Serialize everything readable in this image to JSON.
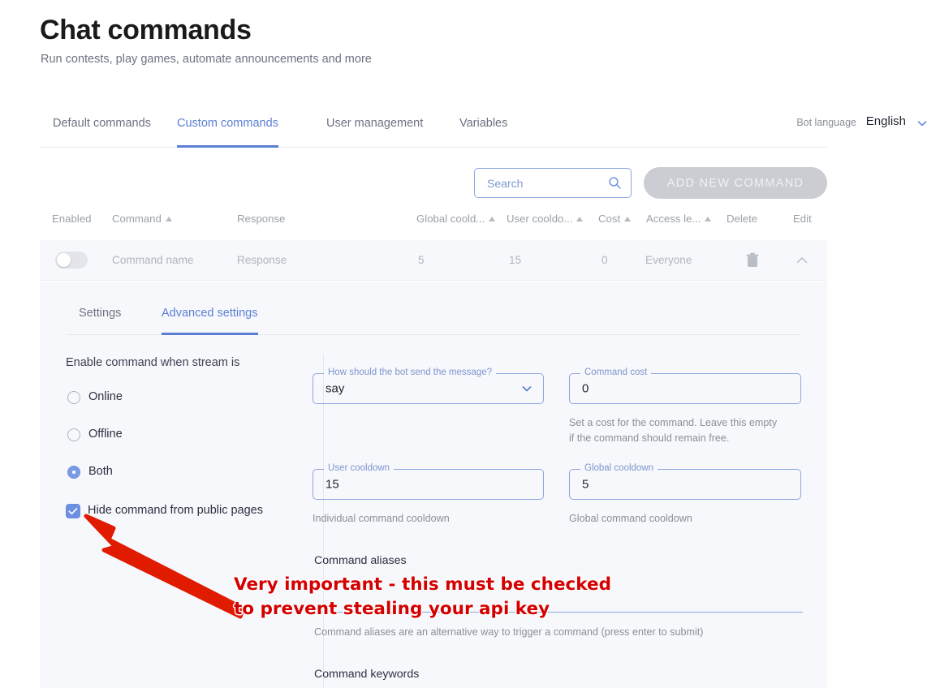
{
  "page": {
    "title": "Chat commands",
    "subtitle": "Run contests, play games, automate announcements and more"
  },
  "tabs": [
    {
      "label": "Default commands",
      "active": false
    },
    {
      "label": "Custom commands",
      "active": true
    },
    {
      "label": "User management",
      "active": false
    },
    {
      "label": "Variables",
      "active": false
    }
  ],
  "bot_language": {
    "label": "Bot language",
    "value": "English",
    "chevron_icon": "chevron-down-icon"
  },
  "toolbar": {
    "search_placeholder": "Search",
    "search_value": "",
    "search_icon": "search-icon",
    "add_button_label": "ADD NEW COMMAND"
  },
  "table": {
    "headers": [
      {
        "label": "Enabled",
        "sortable": false
      },
      {
        "label": "Command",
        "sortable": true
      },
      {
        "label": "Response",
        "sortable": false
      },
      {
        "label": "Global coold...",
        "sortable": true
      },
      {
        "label": "User cooldo...",
        "sortable": true
      },
      {
        "label": "Cost",
        "sortable": true
      },
      {
        "label": "Access le...",
        "sortable": true
      },
      {
        "label": "Delete",
        "sortable": false
      },
      {
        "label": "Edit",
        "sortable": false
      }
    ],
    "row": {
      "enabled": false,
      "command": "Command name",
      "response": "Response",
      "global_cooldown": "5",
      "user_cooldown": "15",
      "cost": "0",
      "access_level": "Everyone",
      "delete_icon": "trash-icon",
      "edit_icon": "chevron-up-icon"
    }
  },
  "panel": {
    "subtabs": [
      {
        "label": "Settings",
        "active": false
      },
      {
        "label": "Advanced settings",
        "active": true
      }
    ],
    "stream_state": {
      "label": "Enable command when stream is",
      "options": [
        {
          "label": "Online",
          "selected": false
        },
        {
          "label": "Offline",
          "selected": false
        },
        {
          "label": "Both",
          "selected": true
        }
      ]
    },
    "hide_command": {
      "label": "Hide command from public pages",
      "checked": true,
      "check_icon": "check-icon"
    },
    "fields": {
      "send_method": {
        "legend": "How should the bot send the message?",
        "value": "say",
        "chevron_icon": "chevron-down-icon"
      },
      "command_cost": {
        "legend": "Command cost",
        "value": "0",
        "helper": "Set a cost for the command. Leave this empty if the command should remain free."
      },
      "user_cooldown": {
        "legend": "User cooldown",
        "value": "15",
        "helper": "Individual command cooldown"
      },
      "global_cooldown": {
        "legend": "Global cooldown",
        "value": "5",
        "helper": "Global command cooldown"
      }
    },
    "aliases": {
      "label": "Command aliases",
      "value": "",
      "helper": "Command aliases are an alternative way to trigger a command (press enter to submit)"
    },
    "keywords": {
      "label": "Command keywords"
    }
  },
  "annotation": {
    "text": "Very important - this must be checked\nto prevent stealing your api key",
    "color": "#d40000",
    "arrow_icon": "arrow-pointer-icon"
  }
}
